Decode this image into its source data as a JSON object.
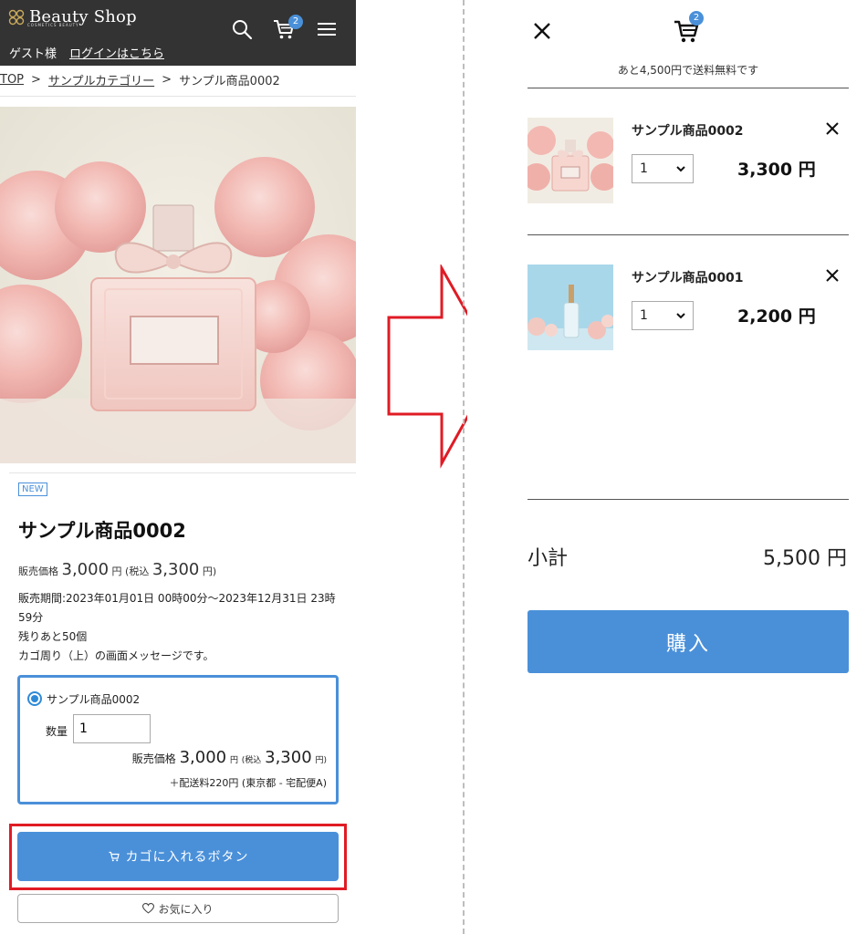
{
  "left": {
    "header": {
      "logo_text": "Beauty Shop",
      "logo_sub": "COSMETICS BEAUTY",
      "guest_label": "ゲスト様",
      "login_link": "ログインはこちら",
      "cart_count": "2",
      "icons": [
        "search-icon",
        "cart-icon",
        "menu-icon"
      ]
    },
    "breadcrumb": [
      "TOP",
      ">",
      "サンプルカテゴリー",
      ">",
      "サンプル商品0002"
    ],
    "product": {
      "badge": "NEW",
      "title": "サンプル商品0002",
      "price_label": "販売価格",
      "price": "3,000",
      "yen": "円",
      "tax_open": "(税込",
      "price_tax": "3,300",
      "tax_close": "円)",
      "info_lines": [
        "販売期間:2023年01月01日 00時00分～2023年12月31日 23時59分",
        "残りあと50個",
        "カゴ周り（上）の画面メッセージです。"
      ]
    },
    "variant": {
      "name": "サンプル商品0002",
      "qty_label": "数量",
      "qty_value": "1",
      "price_label": "販売価格",
      "price": "3,000",
      "yen": "円",
      "tax_open": "(税込",
      "price_tax": "3,300",
      "tax_close": "円)",
      "shipping": "＋配送料220円 (東京都 - 宅配便A)"
    },
    "cart_button": "カゴに入れるボタン",
    "favorite_button": "お気に入り"
  },
  "right": {
    "free_shipping_msg": "あと4,500円で送料無料です",
    "cart_count": "2",
    "items": [
      {
        "name": "サンプル商品0002",
        "qty": "1",
        "price": "3,300 円"
      },
      {
        "name": "サンプル商品0001",
        "qty": "1",
        "price": "2,200 円"
      }
    ],
    "subtotal_label": "小計",
    "subtotal_value": "5,500 円",
    "buy_button": "購入"
  },
  "colors": {
    "header_bg": "#333333",
    "accent_blue": "#4a90d9",
    "highlight_red": "#e01b24"
  }
}
